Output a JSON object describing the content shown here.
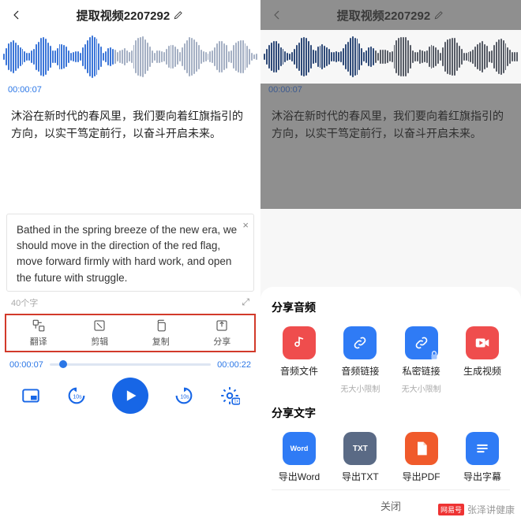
{
  "header": {
    "title": "提取视频2207292"
  },
  "timestamp": "00:00:07",
  "transcript_cn": "沐浴在新时代的春风里，我们要向着红旗指引的方向，以实干笃定前行，以奋斗开启未来。",
  "translation_en": "Bathed in the spring breeze of the new era, we should move in the direction of the red flag, move forward firmly with hard work, and open the future with struggle.",
  "wordcount": "40个字",
  "actions": {
    "translate": "翻译",
    "trim": "剪辑",
    "copy": "复制",
    "share": "分享"
  },
  "playback": {
    "current": "00:00:07",
    "total": "00:00:22"
  },
  "share_sheet": {
    "audio_title": "分享音频",
    "audio_items": [
      {
        "label": "音频文件",
        "sub": ""
      },
      {
        "label": "音频链接",
        "sub": "无大小限制"
      },
      {
        "label": "私密链接",
        "sub": "无大小限制"
      },
      {
        "label": "生成视频",
        "sub": ""
      }
    ],
    "text_title": "分享文字",
    "text_items": [
      {
        "label": "导出Word",
        "tile": "Word"
      },
      {
        "label": "导出TXT",
        "tile": "TXT"
      },
      {
        "label": "导出PDF",
        "tile": ""
      },
      {
        "label": "导出字幕",
        "tile": ""
      }
    ],
    "close": "关闭"
  },
  "watermark": {
    "brand": "网易号",
    "author": "张泽讲健康"
  }
}
